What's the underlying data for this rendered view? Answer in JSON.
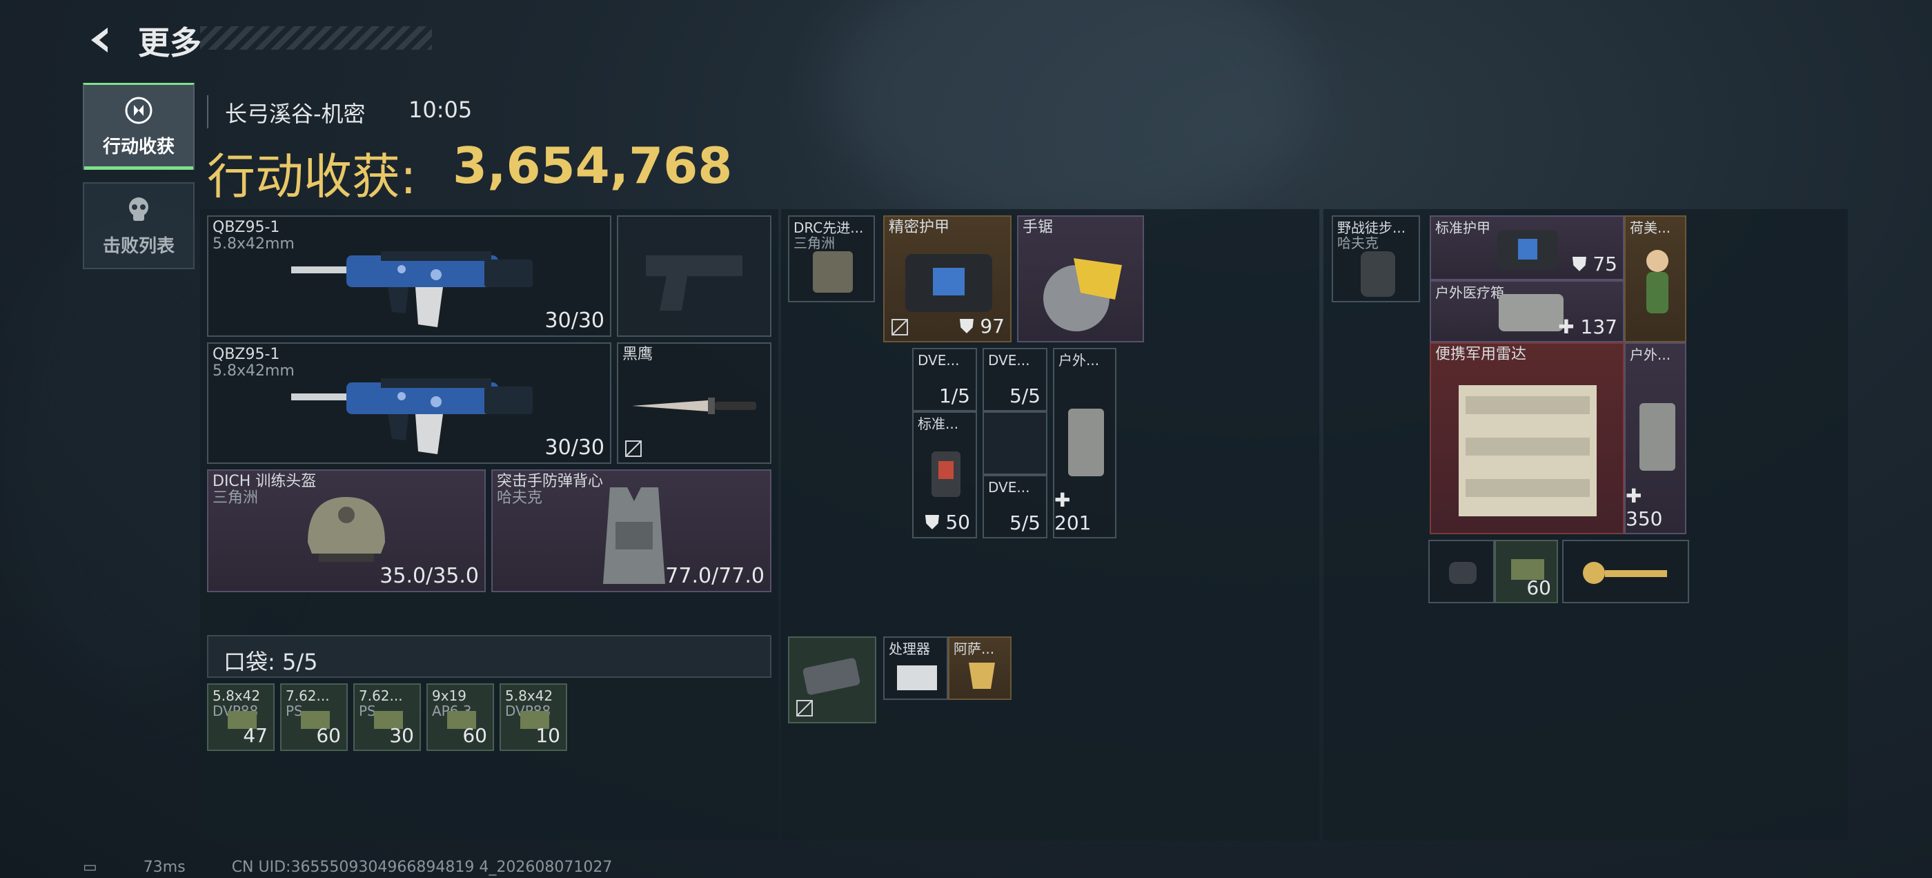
{
  "header": {
    "title": "更多",
    "back_icon": "back-arrow-icon"
  },
  "tabs": [
    {
      "label": "行动收获",
      "icon": "loot-icon",
      "active": true
    },
    {
      "label": "击败列表",
      "icon": "skull-icon",
      "active": false
    }
  ],
  "session": {
    "map": "长弓溪谷-机密",
    "time": "10:05"
  },
  "haul": {
    "label": "行动收获:",
    "value": "3,654,768",
    "color": "#e9c867"
  },
  "loadout": {
    "primary1": {
      "name": "QBZ95-1",
      "caliber": "5.8x42mm",
      "ammo": "30/30"
    },
    "primary2": {
      "name": "QBZ95-1",
      "caliber": "5.8x42mm",
      "ammo": "30/30"
    },
    "melee": {
      "name": "黑鹰"
    },
    "helmet": {
      "name": "DICH 训练头盔",
      "origin": "三角洲",
      "durability": "35.0/35.0"
    },
    "armor": {
      "name": "突击手防弹背心",
      "origin": "哈夫克",
      "durability": "77.0/77.0"
    }
  },
  "pockets": {
    "label": "口袋:",
    "count": "5/5",
    "items": [
      {
        "caliber": "5.8x42",
        "type": "DVP88",
        "qty": "47"
      },
      {
        "caliber": "7.62...",
        "type": "PS",
        "qty": "60"
      },
      {
        "caliber": "7.62...",
        "type": "PS",
        "qty": "30"
      },
      {
        "caliber": "9x19",
        "type": "AP6.3",
        "qty": "60"
      },
      {
        "caliber": "5.8x42",
        "type": "DVP88",
        "qty": "10"
      }
    ]
  },
  "chest_rig": {
    "name": "DRC先进...",
    "origin": "三角洲"
  },
  "middle_items": {
    "precision_armor": {
      "name": "精密护甲",
      "value": "97"
    },
    "hand_saw": {
      "name": "手锯"
    },
    "dve1": {
      "name": "DVE...",
      "qty": "1/5"
    },
    "dve2": {
      "name": "DVE...",
      "qty": "5/5"
    },
    "outdoor1": {
      "name": "户外...",
      "value": "201"
    },
    "standard1": {
      "name": "标准...",
      "value": "50"
    },
    "dve3": {
      "name": "DVE...",
      "qty": "5/5"
    },
    "processor": {
      "name": "处理器"
    },
    "ayurveda": {
      "name": "阿萨..."
    }
  },
  "backpack": {
    "name": "野战徒步...",
    "origin": "哈夫克"
  },
  "right_items": {
    "standard_armor": {
      "name": "标准护甲",
      "value": "75"
    },
    "dutch_item": {
      "name": "荷美..."
    },
    "outdoor_medkit": {
      "name": "户外医疗箱",
      "value": "137"
    },
    "radar": {
      "name": "便携军用雷达"
    },
    "outdoor2": {
      "name": "户外...",
      "value": "350"
    },
    "ammo_box": {
      "qty": "60"
    }
  },
  "footer": {
    "ping": "73ms",
    "uid": "CN UID:3655509304966894819 4_202608071027"
  }
}
